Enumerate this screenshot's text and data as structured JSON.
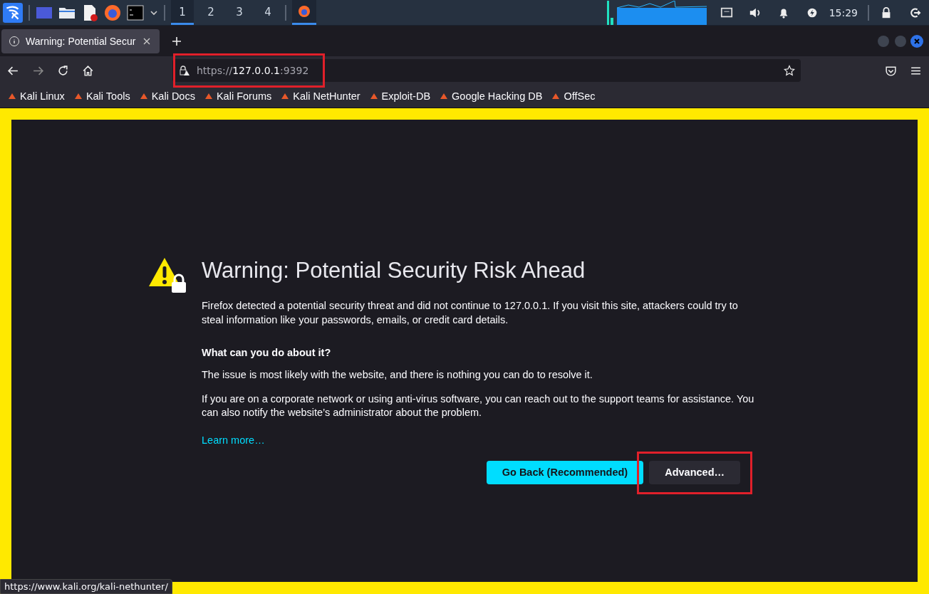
{
  "taskbar": {
    "workspaces": [
      {
        "label": "1",
        "selected": true
      },
      {
        "label": "2",
        "selected": false
      },
      {
        "label": "3",
        "selected": false
      },
      {
        "label": "4",
        "selected": false
      }
    ],
    "clock": "15:29"
  },
  "browser": {
    "tab": {
      "title": "Warning: Potential Secur"
    },
    "url": {
      "scheme": "https://",
      "host": "127.0.0.1",
      "port": ":9392"
    },
    "bookmarks": [
      {
        "label": "Kali Linux"
      },
      {
        "label": "Kali Tools"
      },
      {
        "label": "Kali Docs"
      },
      {
        "label": "Kali Forums"
      },
      {
        "label": "Kali NetHunter"
      },
      {
        "label": "Exploit-DB"
      },
      {
        "label": "Google Hacking DB"
      },
      {
        "label": "OffSec"
      }
    ]
  },
  "page": {
    "title": "Warning: Potential Security Risk Ahead",
    "intro": "Firefox detected a potential security threat and did not continue to 127.0.0.1. If you visit this site, attackers could try to steal information like your passwords, emails, or credit card details.",
    "heading": "What can you do about it?",
    "paragraphs": [
      "The issue is most likely with the website, and there is nothing you can do to resolve it.",
      "If you are on a corporate network or using anti-virus software, you can reach out to the support teams for assistance. You can also notify the website’s administrator about the problem."
    ],
    "link": "Learn more…",
    "buttons": [
      {
        "label": "Go Back (Recommended)",
        "kind": "primary"
      },
      {
        "label": "Advanced…",
        "kind": "secondary"
      }
    ]
  },
  "status_url": "https://www.kali.org/kali-nethunter/"
}
